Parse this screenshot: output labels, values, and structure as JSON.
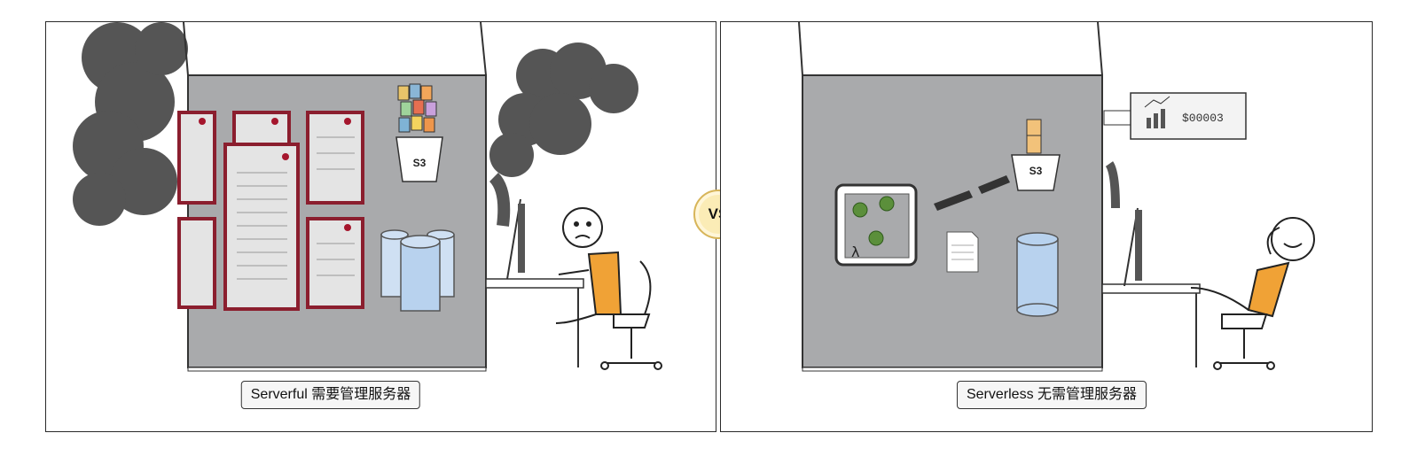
{
  "left": {
    "caption": "Serverful 需要管理服务器",
    "bucket_label": "S3"
  },
  "right": {
    "caption": "Serverless 无需管理服务器",
    "bucket_label": "S3",
    "lambda_symbol": "λ",
    "cost_display": "$00003"
  },
  "vs_label": "VS"
}
